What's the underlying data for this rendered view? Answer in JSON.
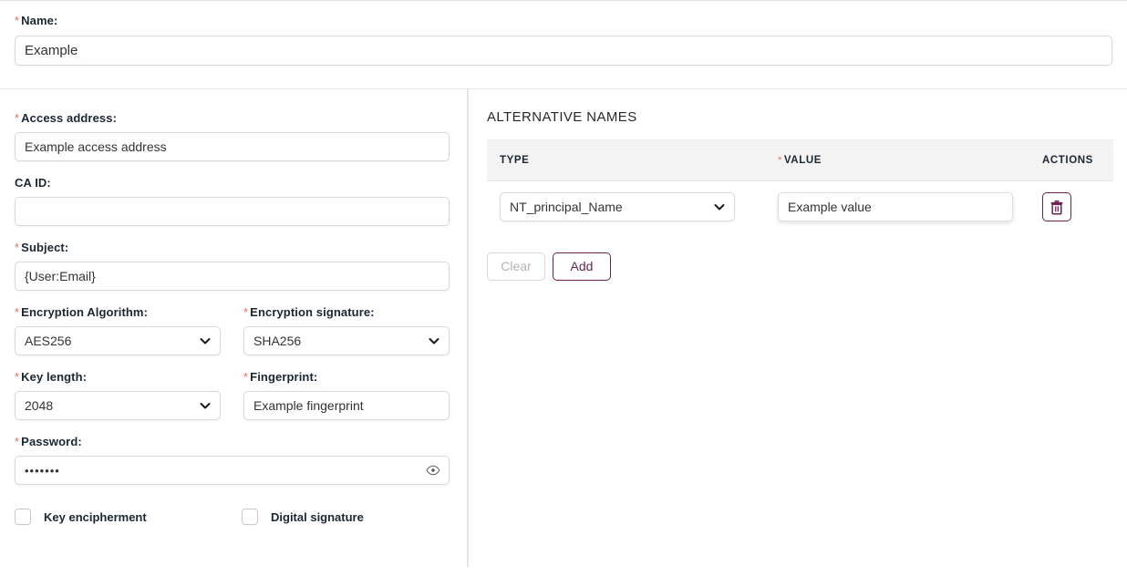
{
  "colors": {
    "accent": "#6b2251",
    "required_asterisk": "#e8705a",
    "label": "#1b2733",
    "table_header_bg": "#f3f3f3",
    "border": "#d9d9d9",
    "disabled_text": "#b3b3b3"
  },
  "form": {
    "name": {
      "label": "Name:",
      "required": true,
      "value": "Example"
    },
    "access_address": {
      "label": "Access address:",
      "required": true,
      "value": "Example access address"
    },
    "ca_id": {
      "label": "CA ID:",
      "required": false,
      "value": ""
    },
    "subject": {
      "label": "Subject:",
      "required": true,
      "value": "{User:Email}"
    },
    "encryption_algorithm": {
      "label": "Encryption Algorithm:",
      "required": true,
      "value": "AES256",
      "options": [
        "AES256"
      ]
    },
    "encryption_signature": {
      "label": "Encryption signature:",
      "required": true,
      "value": "SHA256",
      "options": [
        "SHA256"
      ]
    },
    "key_length": {
      "label": "Key length:",
      "required": true,
      "value": "2048",
      "options": [
        "2048"
      ]
    },
    "fingerprint": {
      "label": "Fingerprint:",
      "required": true,
      "value": "Example fingerprint"
    },
    "password": {
      "label": "Password:",
      "required": true,
      "value": "•••••••",
      "reveal_icon": "eye-icon"
    },
    "checkboxes": [
      {
        "label": "Key encipherment",
        "checked": false
      },
      {
        "label": "Digital signature",
        "checked": false
      }
    ]
  },
  "alternative_names": {
    "title": "ALTERNATIVE NAMES",
    "columns": [
      {
        "key": "type",
        "label": "TYPE",
        "required": false
      },
      {
        "key": "value",
        "label": "VALUE",
        "required": true
      },
      {
        "key": "actions",
        "label": "ACTIONS",
        "required": false
      }
    ],
    "rows": [
      {
        "type": "NT_principal_Name",
        "type_options": [
          "NT_principal_Name"
        ],
        "value": "Example value",
        "delete_icon": "trash-icon"
      }
    ],
    "buttons": {
      "clear": {
        "label": "Clear",
        "disabled": true
      },
      "add": {
        "label": "Add",
        "disabled": false
      }
    }
  }
}
